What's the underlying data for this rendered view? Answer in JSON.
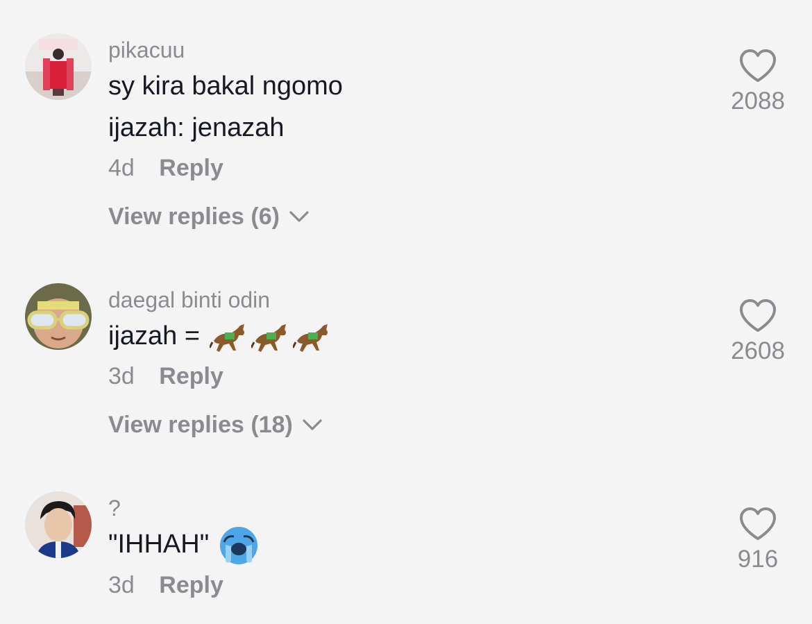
{
  "comments": [
    {
      "username": "pikacuu",
      "lines": [
        "sy kira bakal ngomo",
        "ijazah: jenazah"
      ],
      "time": "4d",
      "reply_label": "Reply",
      "view_replies": "View replies (6)",
      "likes": "2088",
      "avatar_icon": "avatar-person-red-dress"
    },
    {
      "username": "daegal binti odin",
      "line_prefix": "ijazah =",
      "emojis": [
        "horse-racing-icon",
        "horse-racing-icon",
        "horse-racing-icon"
      ],
      "time": "3d",
      "reply_label": "Reply",
      "view_replies": "View replies (18)",
      "likes": "2608",
      "avatar_icon": "avatar-person-sunglasses"
    },
    {
      "username": "?",
      "line_prefix": "\"IHHAH\"",
      "emojis": [
        "crying-face-icon"
      ],
      "time": "3d",
      "reply_label": "Reply",
      "likes": "916",
      "avatar_icon": "avatar-person-dark-hair"
    }
  ],
  "colors": {
    "background": "#f4f4f4",
    "text": "#161823",
    "muted": "#8a8b91"
  }
}
